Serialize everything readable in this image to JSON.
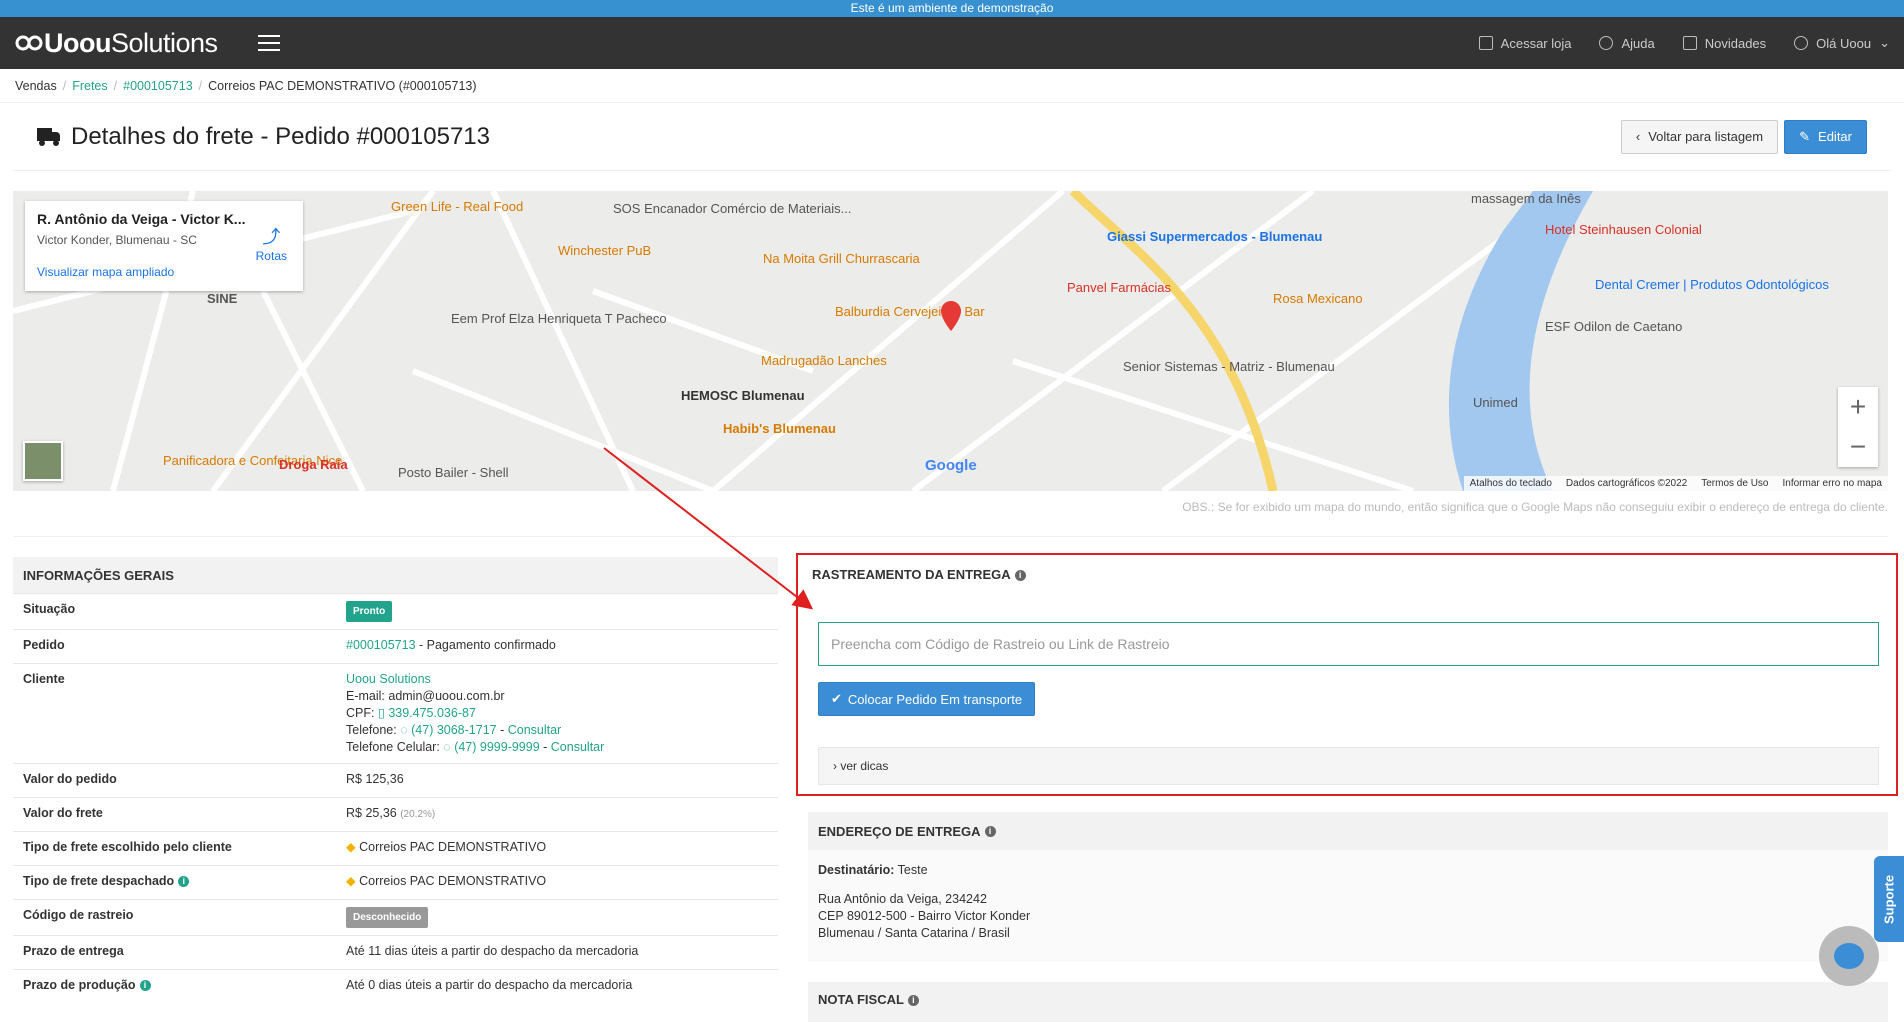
{
  "demo_banner": "Este é um ambiente de demonstração",
  "header": {
    "logo_bold": "Uoou",
    "logo_rest": "Solutions",
    "nav": [
      {
        "label": "Acessar loja",
        "icon": "store-icon"
      },
      {
        "label": "Ajuda",
        "icon": "help-icon"
      },
      {
        "label": "Novidades",
        "icon": "megaphone-icon"
      },
      {
        "label": "Olá Uoou",
        "icon": "user-icon"
      }
    ]
  },
  "breadcrumb": {
    "items": [
      "Vendas",
      "Fretes",
      "#000105713",
      "Correios PAC DEMONSTRATIVO (#000105713)"
    ]
  },
  "page": {
    "title": "Detalhes do frete - Pedido #000105713",
    "back_label": "Voltar para listagem",
    "edit_label": "Editar"
  },
  "map": {
    "card_title": "R. Antônio da Veiga - Victor K...",
    "card_sub": "Victor Konder, Blumenau - SC",
    "card_link": "Visualizar mapa ampliado",
    "routes": "Rotas",
    "labels": [
      "Green Life - Real Food",
      "SOS Encanador Comércio de Materiais...",
      "Winchester PuB",
      "Na Moita Grill Churrascaria",
      "Giassi Supermercados - Blumenau",
      "Panvel Farmácias",
      "Rosa Mexicano",
      "Hotel Steinhausen Colonial",
      "Dental Cremer | Produtos Odontológicos",
      "ESF Odilon de Caetano",
      "Balburdia Cervejeira - Bar",
      "Madrugadão Lanches",
      "HEMOSC Blumenau",
      "Habib's Blumenau",
      "Eem Prof Elza Henriqueta T Pacheco",
      "Senior Sistemas - Matriz - Blumenau",
      "Unimed",
      "Panificadora e Confeitaria Nice",
      "Droga Raia",
      "Posto Bailer - Shell",
      "SINE",
      "massagem da Inês"
    ],
    "google": "Google",
    "footer": [
      "Atalhos do teclado",
      "Dados cartográficos ©2022",
      "Termos de Uso",
      "Informar erro no mapa"
    ],
    "obs": "OBS.: Se for exibido um mapa do mundo, então significa que o Google Maps não conseguiu exibir o endereço de entrega do cliente."
  },
  "info": {
    "header": "INFORMAÇÕES GERAIS",
    "situacao_label": "Situação",
    "situacao_value": "Pronto",
    "pedido_label": "Pedido",
    "pedido_link": "#000105713",
    "pedido_status": " - Pagamento confirmado",
    "cliente_label": "Cliente",
    "cliente_name": "Uoou Solutions",
    "cliente_email": "E-mail: admin@uoou.com.br",
    "cpf_label": "CPF: ",
    "cpf_value": "339.475.036-87",
    "tel_label": "Telefone: ",
    "tel_value": "(47) 3068-1717",
    "cel_label": "Telefone Celular: ",
    "cel_value": "(47) 9999-9999",
    "consultar": "Consultar",
    "valor_pedido_label": "Valor do pedido",
    "valor_pedido": "R$ 125,36",
    "valor_frete_label": "Valor do frete",
    "valor_frete": "R$ 25,36",
    "valor_frete_pct": "(20.2%)",
    "tipo_cliente_label": "Tipo de frete escolhido pelo cliente",
    "tipo_cliente": "Correios PAC DEMONSTRATIVO",
    "tipo_desp_label": "Tipo de frete despachado",
    "tipo_desp": "Correios PAC DEMONSTRATIVO",
    "codigo_label": "Código de rastreio",
    "codigo_value": "Desconhecido",
    "prazo_entrega_label": "Prazo de entrega",
    "prazo_entrega": "Até 11 dias úteis a partir do despacho da mercadoria",
    "prazo_prod_label": "Prazo de produção",
    "prazo_prod": "Até 0 dias úteis a partir do despacho da mercadoria"
  },
  "tracking": {
    "header": "RASTREAMENTO DA ENTREGA",
    "placeholder": "Preencha com Código de Rastreio ou Link de Rastreio",
    "button": "Colocar Pedido Em transporte",
    "tips": "› ver dicas"
  },
  "address": {
    "header": "ENDEREÇO DE ENTREGA",
    "dest_label": "Destinatário:",
    "dest_value": " Teste",
    "line1": "Rua Antônio da Veiga, 234242",
    "line2": "CEP 89012-500 - Bairro Victor Konder",
    "line3": "Blumenau / Santa Catarina / Brasil"
  },
  "nota": {
    "header": "NOTA FISCAL"
  },
  "support": "Suporte",
  "colors": {
    "teal": "#22a38b",
    "blue": "#3b8ed6",
    "red": "#e02020",
    "topbar": "#333333"
  }
}
